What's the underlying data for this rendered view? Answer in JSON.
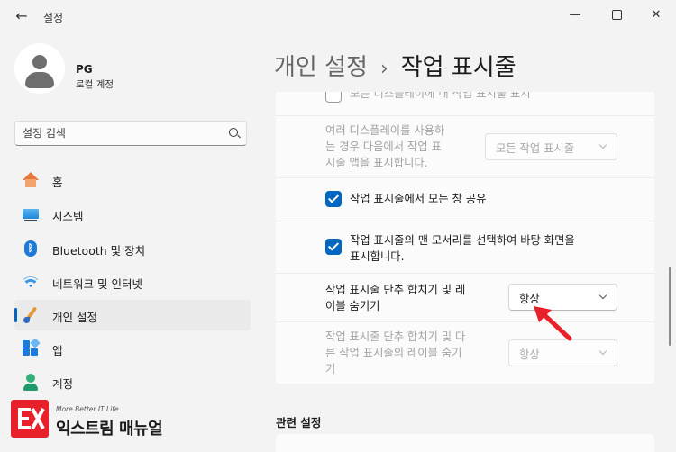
{
  "window": {
    "title": "설정",
    "back_icon": "back-arrow-icon",
    "controls": {
      "minimize": "—",
      "close": "✕"
    }
  },
  "profile": {
    "name": "PG",
    "account_type": "로컬 계정"
  },
  "search": {
    "placeholder": "설정 검색"
  },
  "sidebar": {
    "items": [
      {
        "label": "홈",
        "icon": "home-icon"
      },
      {
        "label": "시스템",
        "icon": "system-icon"
      },
      {
        "label": "Bluetooth 및 장치",
        "icon": "bluetooth-icon"
      },
      {
        "label": "네트워크 및 인터넷",
        "icon": "wifi-icon"
      },
      {
        "label": "개인 설정",
        "icon": "personalization-icon",
        "selected": true
      },
      {
        "label": "앱",
        "icon": "apps-icon"
      },
      {
        "label": "계정",
        "icon": "account-icon"
      }
    ]
  },
  "breadcrumb": {
    "parent": "개인 설정",
    "separator": "›",
    "current": "작업 표시줄"
  },
  "settings": {
    "all_displays": {
      "label": "모든 디스플레이에 내 작업 표시줄 표시",
      "checked": false,
      "enabled": false
    },
    "multi_display_show": {
      "line1": "여러 디스플레이를 사용하",
      "line2": "는 경우 다음에서 작업 표",
      "line3": "시줄 앱을 표시합니다.",
      "value": "모든 작업 표시줄",
      "enabled": false
    },
    "share_windows": {
      "label": "작업 표시줄에서 모든 창 공유",
      "checked": true
    },
    "far_corner": {
      "line1": "작업 표시줄의 맨 모서리를 선택하여 바탕 화면을",
      "line2": "표시합니다.",
      "checked": true
    },
    "combine_buttons": {
      "line1": "작업 표시줄 단추 합치기 및 레",
      "line2": "이블 숨기기",
      "value": "항상",
      "enabled": true
    },
    "combine_other": {
      "line1": "작업 표시줄 단추 합치기 및 다",
      "line2": "른 작업 표시줄의 레이블 숨기",
      "line3": "기",
      "value": "항상",
      "enabled": false
    }
  },
  "related": {
    "title": "관련 설정"
  },
  "annotation": {
    "color": "#e8202a"
  },
  "watermark": {
    "tagline": "More Better IT Life",
    "brand": "익스트림 매뉴얼"
  },
  "colors": {
    "accent": "#0067c0",
    "background": "#f3f3f3",
    "card": "#fbfbfb"
  }
}
